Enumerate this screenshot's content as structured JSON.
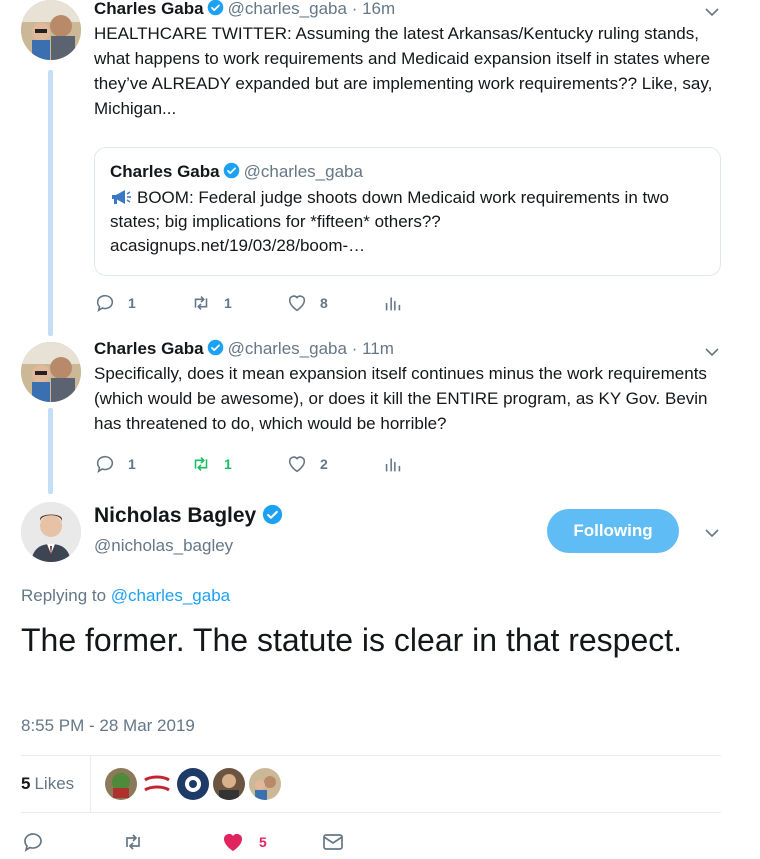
{
  "thread": [
    {
      "name": "Charles Gaba",
      "handle": "@charles_gaba",
      "time": "· 16m",
      "text": "HEALTHCARE TWITTER: Assuming the latest Arkansas/Kentucky ruling stands, what happens to work requirements and Medicaid expansion itself in states where they’ve ALREADY expanded but are implementing work requirements?? Like, say, Michigan...",
      "quote": {
        "name": "Charles Gaba",
        "handle": "@charles_gaba",
        "text": "BOOM: Federal judge shoots down Medicaid work requirements in two states; big implications for *fifteen* others??",
        "link": "acasignups.net/19/03/28/boom-…"
      },
      "replies": "1",
      "retweets": "1",
      "likes": "8"
    },
    {
      "name": "Charles Gaba",
      "handle": "@charles_gaba",
      "time": "· 11m",
      "text": "Specifically, does it mean expansion itself continues minus the work requirements (which would be awesome), or does it kill the ENTIRE program, as KY Gov. Bevin has threatened to do, which would be horrible?",
      "replies": "1",
      "retweets": "1",
      "likes": "2"
    }
  ],
  "main_tweet": {
    "name": "Nicholas Bagley",
    "handle": "@nicholas_bagley",
    "follow_label": "Following",
    "replying_prefix": "Replying to",
    "replying_to": "@charles_gaba",
    "text": "The former. The statute is clear in that respect.",
    "timestamp": "8:55 PM - 28 Mar 2019",
    "likes_count": "5",
    "likes_word": "Likes",
    "heart_count": "5"
  },
  "colors": {
    "accent": "#1da1f2",
    "retweet_green": "#17bf63",
    "like_red": "#e0245e",
    "muted": "#657786",
    "thread_line": "#c4dff5"
  },
  "icons": [
    "verified-badge-icon",
    "chevron-down-icon",
    "reply-icon",
    "retweet-icon",
    "like-icon",
    "analytics-icon",
    "direct-message-icon",
    "megaphone-icon"
  ]
}
